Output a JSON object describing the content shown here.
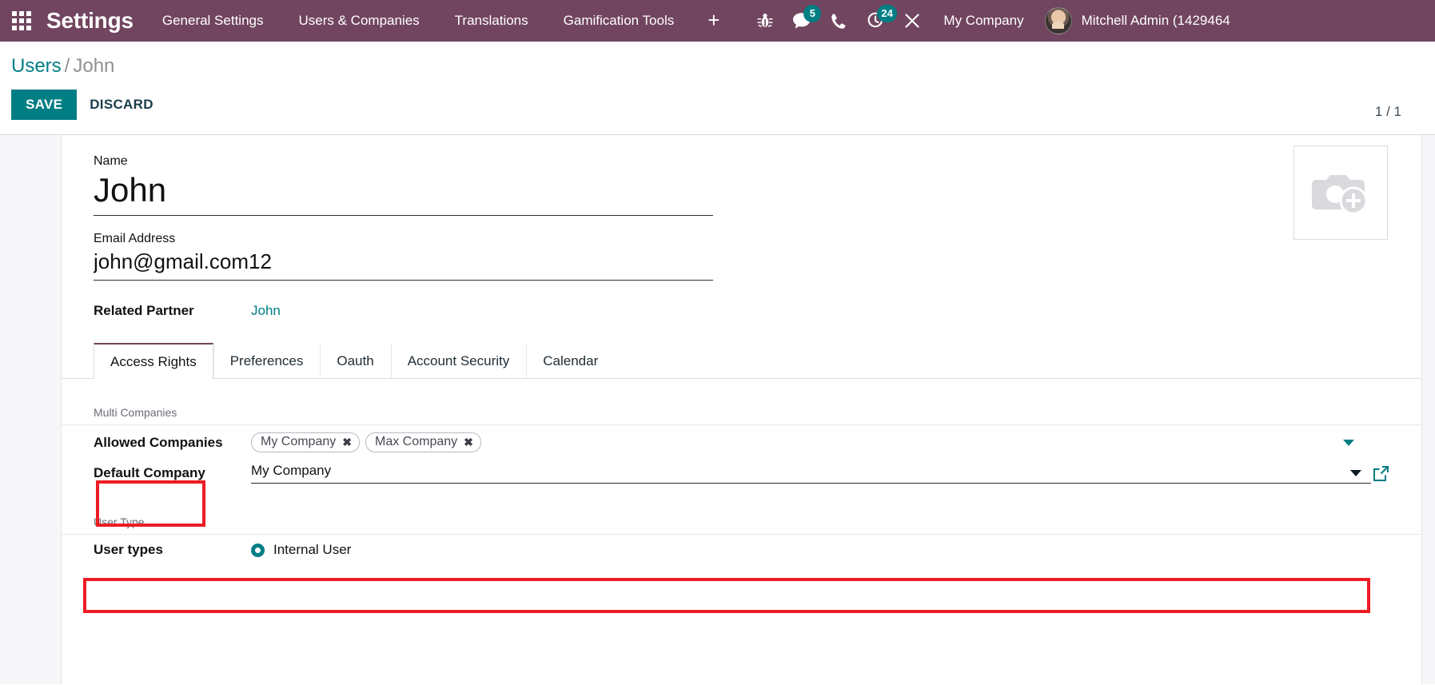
{
  "navbar": {
    "apps_icon": "apps-grid-icon",
    "brand": "Settings",
    "menu_items": [
      {
        "label": "General Settings"
      },
      {
        "label": "Users & Companies"
      },
      {
        "label": "Translations"
      },
      {
        "label": "Gamification Tools"
      }
    ],
    "plus_label": "+",
    "systray": [
      {
        "name": "debug-bug-icon",
        "badge": null
      },
      {
        "name": "messages-icon",
        "badge": "5"
      },
      {
        "name": "phone-icon",
        "badge": null
      },
      {
        "name": "activities-clock-icon",
        "badge": "24"
      },
      {
        "name": "tools-wrench-icon",
        "badge": null
      }
    ],
    "company": "My Company",
    "user": "Mitchell Admin (1429464"
  },
  "control_panel": {
    "breadcrumb_root": "Users",
    "breadcrumb_separator": "/",
    "breadcrumb_current": "John",
    "save_label": "SAVE",
    "discard_label": "DISCARD",
    "pager": "1 / 1"
  },
  "form": {
    "name_label": "Name",
    "name_value": "John",
    "email_label": "Email Address",
    "email_value": "john@gmail.com12",
    "related_partner_label": "Related Partner",
    "related_partner_value": "John",
    "avatar_placeholder_icon": "camera-add-icon"
  },
  "notebook": {
    "tabs": [
      {
        "label": "Access Rights",
        "active": true
      },
      {
        "label": "Preferences",
        "active": false
      },
      {
        "label": "Oauth",
        "active": false
      },
      {
        "label": "Account Security",
        "active": false
      },
      {
        "label": "Calendar",
        "active": false
      }
    ]
  },
  "access_rights": {
    "multi_companies": {
      "group_title": "Multi Companies",
      "allowed_companies_label": "Allowed Companies",
      "allowed_companies_tags": [
        {
          "label": "My Company",
          "remove_icon": "✖"
        },
        {
          "label": "Max Company",
          "remove_icon": "✖"
        }
      ],
      "allowed_companies_caret": "chevron-down-icon",
      "default_company_label": "Default Company",
      "default_company_value": "My Company",
      "default_company_caret": "chevron-down-icon",
      "default_company_external": "external-link-icon"
    },
    "user_type": {
      "group_title": "User Type",
      "user_types_label": "User types",
      "selected_option": "Internal User"
    }
  },
  "colors": {
    "navbar_bg": "#71455f",
    "accent_teal": "#017e84",
    "annotation_red": "#ed1c24",
    "page_bg": "#f7f7f9"
  }
}
